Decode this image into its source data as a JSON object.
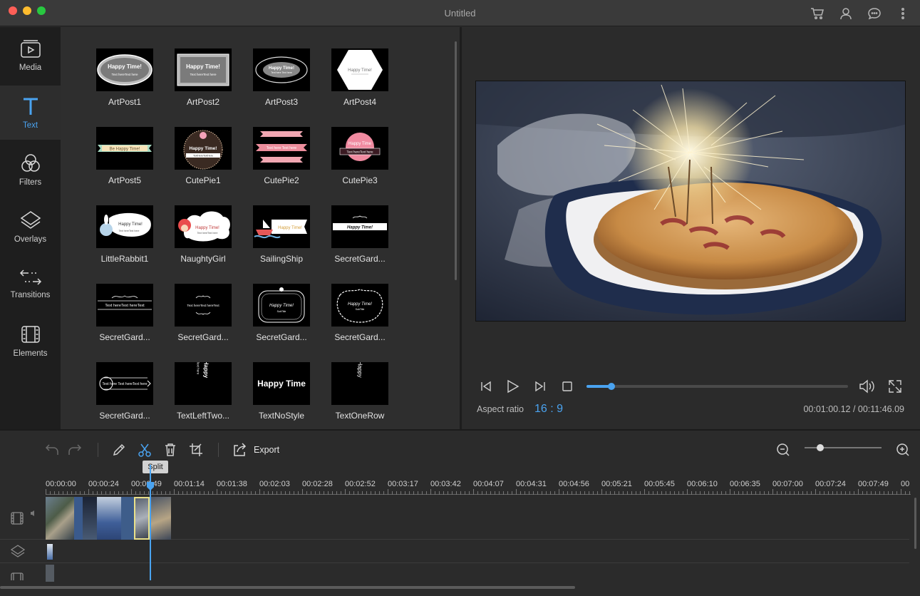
{
  "window": {
    "title": "Untitled"
  },
  "titlebar_icons": [
    "cart-icon",
    "user-icon",
    "chat-icon",
    "more-icon"
  ],
  "sidebar": {
    "items": [
      {
        "label": "Media",
        "icon": "media-icon",
        "active": false
      },
      {
        "label": "Text",
        "icon": "text-icon",
        "active": true
      },
      {
        "label": "Filters",
        "icon": "filters-icon",
        "active": false
      },
      {
        "label": "Overlays",
        "icon": "overlays-icon",
        "active": false
      },
      {
        "label": "Transitions",
        "icon": "transitions-icon",
        "active": false
      },
      {
        "label": "Elements",
        "icon": "elements-icon",
        "active": false
      }
    ]
  },
  "library": {
    "items": [
      {
        "label": "ArtPost1",
        "thumb_text": "Happy Time!"
      },
      {
        "label": "ArtPost2",
        "thumb_text": "Happy Time!"
      },
      {
        "label": "ArtPost3",
        "thumb_text": "Happy Time!"
      },
      {
        "label": "ArtPost4",
        "thumb_text": "Happy Time!"
      },
      {
        "label": "ArtPost5",
        "thumb_text": "Be Happy Time!"
      },
      {
        "label": "CutePie1",
        "thumb_text": "Happy Time!"
      },
      {
        "label": "CutePie2",
        "thumb_text": "Text here Text here"
      },
      {
        "label": "CutePie3",
        "thumb_text": "Happy Time"
      },
      {
        "label": "LittleRabbit1",
        "thumb_text": "Happy Time!"
      },
      {
        "label": "NaughtyGirl",
        "thumb_text": "Happy Time!"
      },
      {
        "label": "SailingShip",
        "thumb_text": "Happy Time!"
      },
      {
        "label": "SecretGard...",
        "thumb_text": "Happy Time!"
      },
      {
        "label": "SecretGard...",
        "thumb_text": "Text hereText hereText"
      },
      {
        "label": "SecretGard...",
        "thumb_text": "Text hereText hereText"
      },
      {
        "label": "SecretGard...",
        "thumb_text": "Happy Time!"
      },
      {
        "label": "SecretGard...",
        "thumb_text": "Happy Time!"
      },
      {
        "label": "SecretGard...",
        "thumb_text": "Text hereText hereText"
      },
      {
        "label": "TextLeftTwo...",
        "thumb_text": "Happy"
      },
      {
        "label": "TextNoStyle",
        "thumb_text": "Happy Time"
      },
      {
        "label": "TextOneRow",
        "thumb_text": "Happy"
      }
    ]
  },
  "player": {
    "progress": 0.095,
    "aspect_label": "Aspect ratio",
    "aspect_value": "16 : 9",
    "timecode": "00:01:00.12 / 00:11:46.09"
  },
  "toolbar": {
    "export_label": "Export",
    "split_tooltip": "Split",
    "zoom_level": 0.2
  },
  "timeline": {
    "ruler": [
      "00:00:00",
      "00:00:24",
      "00:00:49",
      "00:01:14",
      "00:01:38",
      "00:02:03",
      "00:02:28",
      "00:02:52",
      "00:03:17",
      "00:03:42",
      "00:04:07",
      "00:04:31",
      "00:04:56",
      "00:05:21",
      "00:05:45",
      "00:06:10",
      "00:06:35",
      "00:07:00",
      "00:07:24",
      "00:07:49",
      "00"
    ]
  },
  "colors": {
    "accent": "#4aa3f0",
    "selected_clip": "#e9e08a"
  }
}
